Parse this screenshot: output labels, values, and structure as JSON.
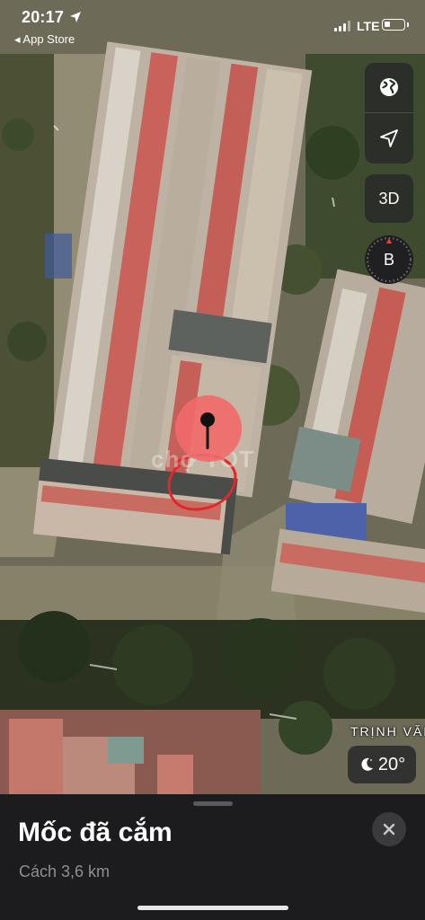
{
  "status_bar": {
    "time": "20:17",
    "back_label": "◂ App Store",
    "network": "LTE",
    "battery_level": 0.3
  },
  "map": {
    "watermark": "chợ TỐT",
    "street_label": "TRỊNH VĂN",
    "controls": {
      "globe_icon": "globe-icon",
      "location_icon": "location-arrow-icon",
      "three_d_label": "3D",
      "compass_letter": "B"
    },
    "weather": {
      "icon": "moon-icon",
      "temperature": "20°"
    },
    "pin_color": "#f06a6a",
    "circle_mark_color": "#e0282a"
  },
  "sheet": {
    "title": "Mốc đã cắm",
    "distance": "Cách 3,6 km",
    "close_icon": "close-icon"
  }
}
